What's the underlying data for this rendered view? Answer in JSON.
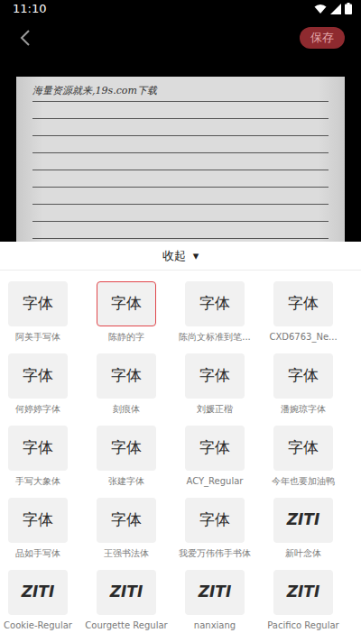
{
  "status_bar": {
    "time": "11:10"
  },
  "header": {
    "save": "保存"
  },
  "document": {
    "first_line": "海量资源就来,19s.com下载"
  },
  "sheet": {
    "toggle": "收起",
    "toggle_icon": "▾"
  },
  "fonts": [
    {
      "preview": "字体",
      "label": "阿美手写体",
      "selected": false,
      "kind": "cjk"
    },
    {
      "preview": "字体",
      "label": "陈静的字",
      "selected": true,
      "kind": "cjk"
    },
    {
      "preview": "字体",
      "label": "陈尚文标准到笔...",
      "selected": false,
      "kind": "cjk"
    },
    {
      "preview": "字体",
      "label": "CXD6763_Ne...",
      "selected": false,
      "kind": "cjk"
    },
    {
      "preview": "字体",
      "label": "何婷婷字体",
      "selected": false,
      "kind": "cjk"
    },
    {
      "preview": "字体",
      "label": "刻痕体",
      "selected": false,
      "kind": "cjk"
    },
    {
      "preview": "字体",
      "label": "刘媛正楷",
      "selected": false,
      "kind": "cjk"
    },
    {
      "preview": "字体",
      "label": "潘婉琼字体",
      "selected": false,
      "kind": "cjk"
    },
    {
      "preview": "字体",
      "label": "手写大象体",
      "selected": false,
      "kind": "cjk"
    },
    {
      "preview": "字体",
      "label": "张建字体",
      "selected": false,
      "kind": "cjk"
    },
    {
      "preview": "字体",
      "label": "ACY_Regular",
      "selected": false,
      "kind": "cjk"
    },
    {
      "preview": "字体",
      "label": "今年也要加油鸭",
      "selected": false,
      "kind": "cjk"
    },
    {
      "preview": "字体",
      "label": "品如手写体",
      "selected": false,
      "kind": "cjk"
    },
    {
      "preview": "字体",
      "label": "王强书法体",
      "selected": false,
      "kind": "cjk"
    },
    {
      "preview": "字体",
      "label": "我爱万伟伟手书体",
      "selected": false,
      "kind": "cjk"
    },
    {
      "preview": "ZITI",
      "label": "新叶念体",
      "selected": false,
      "kind": "latin"
    },
    {
      "preview": "ZITI",
      "label": "Cookie-Regular",
      "selected": false,
      "kind": "latin"
    },
    {
      "preview": "ZITI",
      "label": "Courgette Regular",
      "selected": false,
      "kind": "latin"
    },
    {
      "preview": "ZITI",
      "label": "nanxiang",
      "selected": false,
      "kind": "latin"
    },
    {
      "preview": "ZITI",
      "label": "Pacifico Regular",
      "selected": false,
      "kind": "latin"
    }
  ]
}
